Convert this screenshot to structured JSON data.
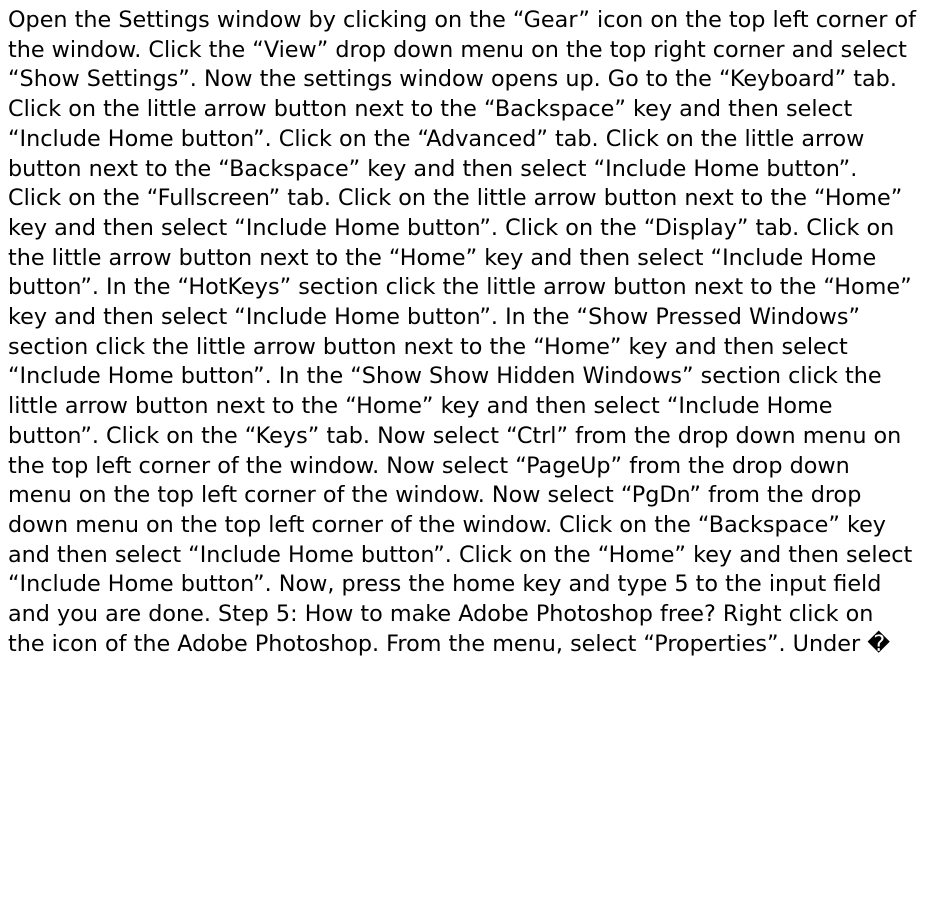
{
  "document": {
    "text": "Open the Settings window by clicking on the “Gear” icon on the top left corner of the window. Click the “View” drop down menu on the top right corner and select “Show Settings”. Now the settings window opens up. Go to the “Keyboard” tab. Click on the little arrow button next to the “Backspace” key and then select “Include Home button”. Click on the “Advanced” tab. Click on the little arrow button next to the “Backspace” key and then select “Include Home button”. Click on the “Fullscreen” tab. Click on the little arrow button next to the “Home” key and then select “Include Home button”. Click on the “Display” tab. Click on the little arrow button next to the “Home” key and then select “Include Home button”. In the “HotKeys” section click the little arrow button next to the “Home” key and then select “Include Home button”. In the “Show Pressed Windows” section click the little arrow button next to the “Home” key and then select “Include Home button”. In the “Show Show Hidden Windows” section click the little arrow button next to the “Home” key and then select “Include Home button”. Click on the “Keys” tab. Now select “Ctrl” from the drop down menu on the top left corner of the window. Now select “PageUp” from the drop down menu on the top left corner of the window. Now select “PgDn” from the drop down menu on the top left corner of the window. Click on the “Backspace” key and then select “Include Home button”. Click on the “Home” key and then select “Include Home button”. Now, press the home key and type 5 to the input field and you are done. Step 5: How to make Adobe Photoshop free? Right click on the icon of the Adobe Photoshop. From the menu, select “Properties”. Under �"
  },
  "colors": {
    "background": "#ffffff",
    "text": "#000000"
  }
}
